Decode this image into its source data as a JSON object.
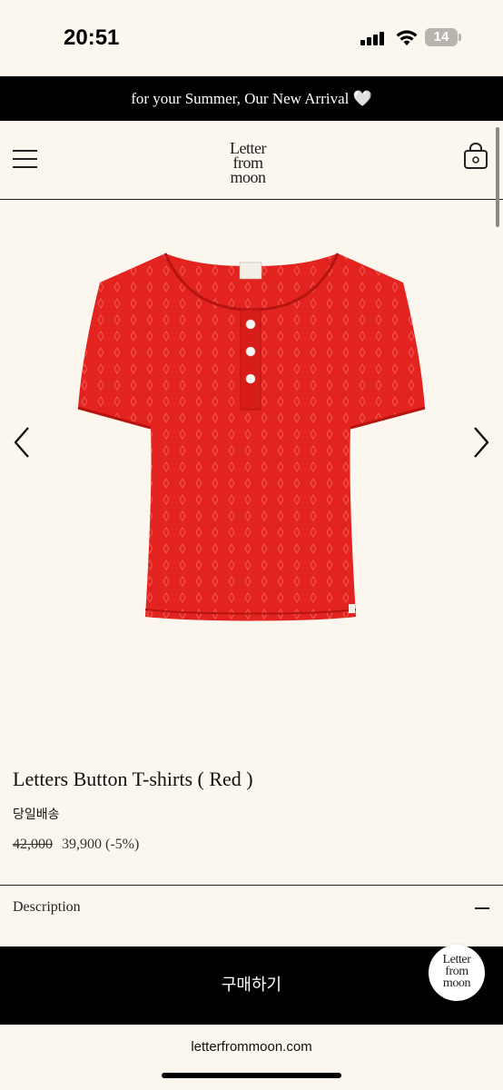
{
  "status_bar": {
    "time": "20:51",
    "battery": "14"
  },
  "announcement": {
    "text": "for your Summer, Our New Arrival 🤍"
  },
  "header": {
    "logo_lines": [
      "Letter",
      "from",
      "moon"
    ],
    "menu_icon": "hamburger-icon",
    "cart_icon": "shopping-bag-icon"
  },
  "product": {
    "name": "Letters Button T-shirts ( Red )",
    "shipping": "당일배송",
    "original_price": "42,000",
    "sale_price": "39,900",
    "discount": "(-5%)",
    "color_hex": "#e3231f"
  },
  "description": {
    "label": "Description"
  },
  "buy": {
    "label": "구매하기"
  },
  "floating_logo_lines": [
    "Letter",
    "from",
    "moon"
  ],
  "browser": {
    "url": "letterfrommoon.com"
  }
}
